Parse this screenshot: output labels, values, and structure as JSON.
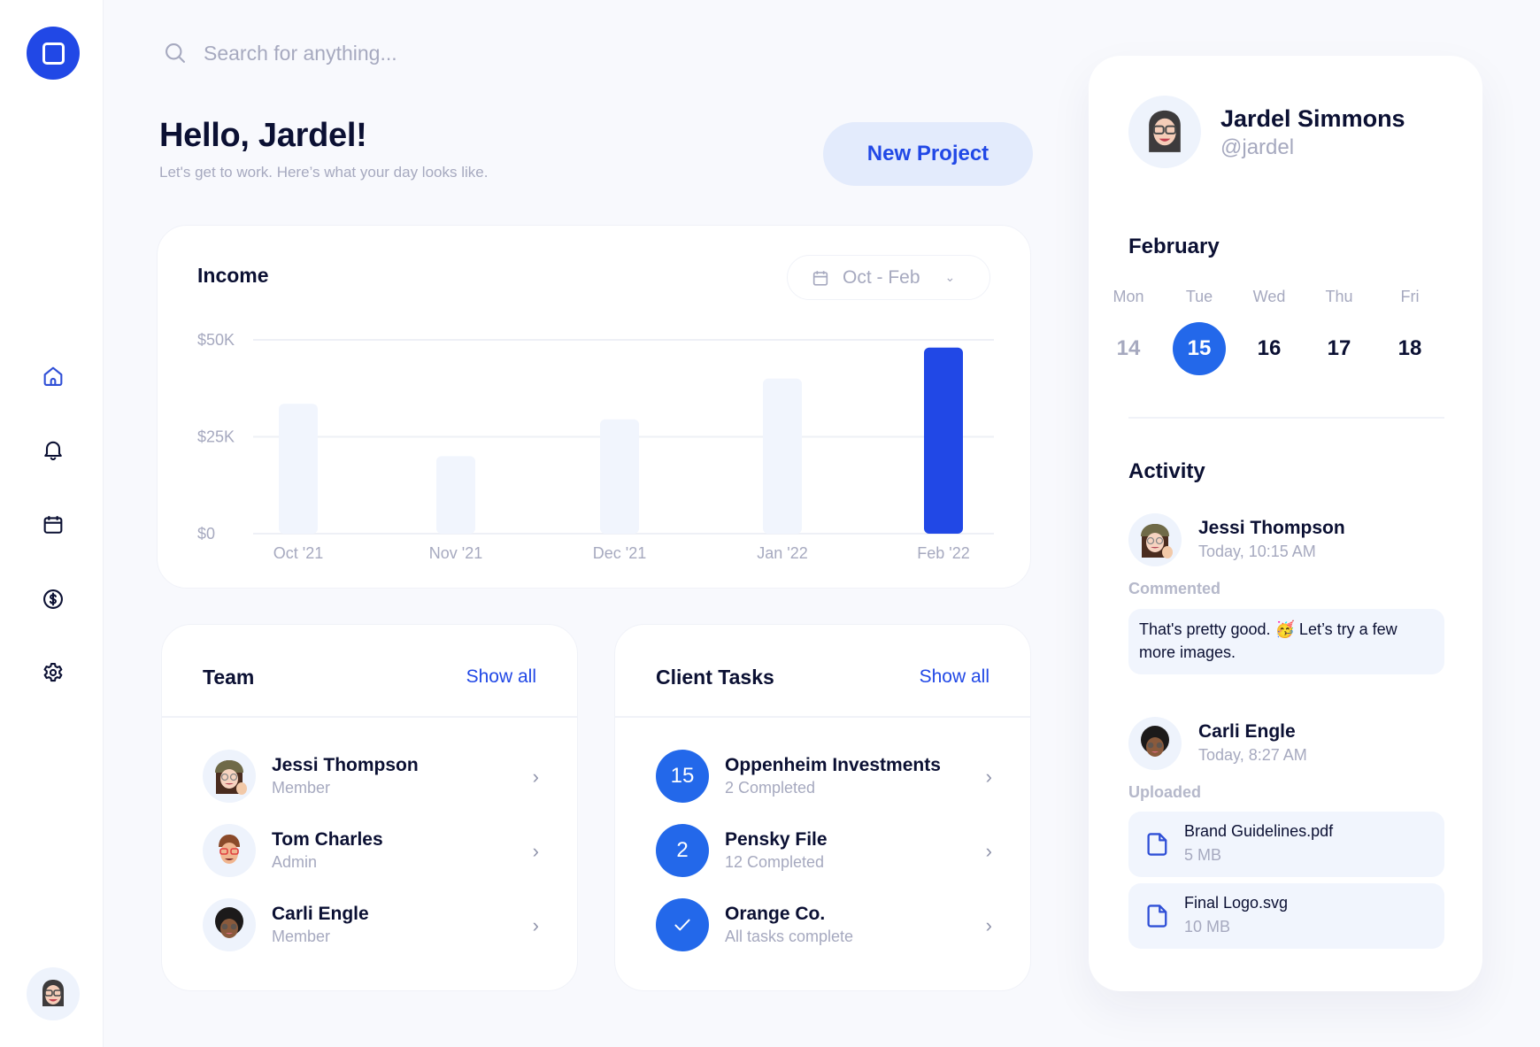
{
  "app": {
    "logo": "app-logo",
    "accent_color": "#2148e6"
  },
  "sidebar": {
    "items": [
      {
        "icon": "home-icon",
        "label": "Home",
        "active": true
      },
      {
        "icon": "bell-icon",
        "label": "Notifications",
        "active": false
      },
      {
        "icon": "calendar-icon",
        "label": "Calendar",
        "active": false
      },
      {
        "icon": "dollar-icon",
        "label": "Finance",
        "active": false
      },
      {
        "icon": "gear-icon",
        "label": "Settings",
        "active": false
      }
    ],
    "user_avatar": "Jardel Simmons"
  },
  "search": {
    "placeholder": "Search for anything...",
    "value": ""
  },
  "header": {
    "greeting": "Hello, Jardel!",
    "subtitle": "Let's get to work. Here’s what your day looks like.",
    "new_project_label": "New Project"
  },
  "income": {
    "title": "Income",
    "range_label": "Oct - Feb"
  },
  "chart_data": {
    "type": "bar",
    "title": "Income",
    "categories": [
      "Oct '21",
      "Nov '21",
      "Dec '21",
      "Jan '22",
      "Feb '22"
    ],
    "values": [
      33500,
      20000,
      29500,
      40000,
      48000
    ],
    "highlighted_index": 4,
    "highlight_color": "#2148e6",
    "bar_color": "#f1f5fd",
    "yticks": [
      0,
      25000,
      50000
    ],
    "ytick_labels": [
      "$0",
      "$25K",
      "$50K"
    ],
    "ylim": [
      0,
      50000
    ],
    "xlabel": "",
    "ylabel": "",
    "grid": true
  },
  "team": {
    "title": "Team",
    "show_all_label": "Show all",
    "members": [
      {
        "name": "Jessi Thompson",
        "role": "Member",
        "avatar": "jessi"
      },
      {
        "name": "Tom Charles",
        "role": "Admin",
        "avatar": "tom"
      },
      {
        "name": "Carli Engle",
        "role": "Member",
        "avatar": "carli"
      }
    ]
  },
  "client_tasks": {
    "title": "Client Tasks",
    "show_all_label": "Show all",
    "tasks": [
      {
        "badge": "15",
        "name": "Oppenheim Investments",
        "status": "2 Completed",
        "complete": false
      },
      {
        "badge": "2",
        "name": "Pensky File",
        "status": "12 Completed",
        "complete": false
      },
      {
        "badge": "✓",
        "name": "Orange Co.",
        "status": "All tasks complete",
        "complete": true
      }
    ]
  },
  "profile": {
    "name": "Jardel Simmons",
    "handle": "@jardel"
  },
  "calendar": {
    "month": "February",
    "days": [
      {
        "weekday": "Mon",
        "date": "14",
        "state": "past"
      },
      {
        "weekday": "Tue",
        "date": "15",
        "state": "today"
      },
      {
        "weekday": "Wed",
        "date": "16",
        "state": "upcoming"
      },
      {
        "weekday": "Thu",
        "date": "17",
        "state": "upcoming"
      },
      {
        "weekday": "Fri",
        "date": "18",
        "state": "upcoming"
      }
    ]
  },
  "activity": {
    "title": "Activity",
    "entries": [
      {
        "user": "Jessi Thompson",
        "time": "Today, 10:15 AM",
        "action": "Commented",
        "comment": "That's pretty good. 🥳 Let’s try a few more images."
      },
      {
        "user": "Carli Engle",
        "time": "Today, 8:27 AM",
        "action": "Uploaded",
        "files": [
          {
            "name": "Brand Guidelines.pdf",
            "size": "5 MB"
          },
          {
            "name": "Final Logo.svg",
            "size": "10 MB"
          }
        ]
      }
    ]
  }
}
